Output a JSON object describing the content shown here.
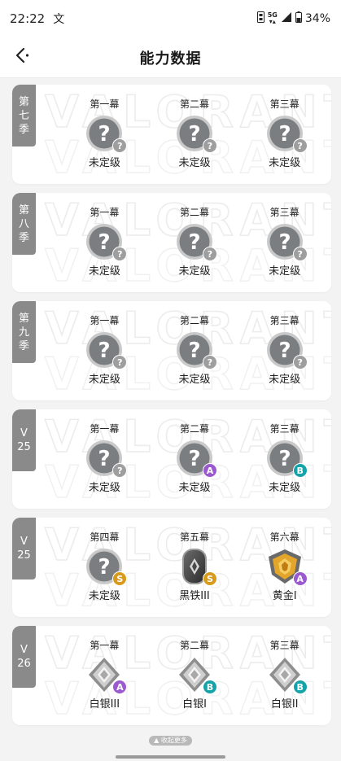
{
  "status_bar": {
    "time": "22:22",
    "notification_glyph": "文",
    "network": "5G",
    "battery": "34%"
  },
  "nav": {
    "title": "能力数据"
  },
  "colors": {
    "tab_bg": "#8a8a8a",
    "badge_gray": "#9e9e9e",
    "badge_purple": "#9b59d0",
    "badge_teal": "#14a3a8",
    "badge_gold": "#d79a1c"
  },
  "seasons": [
    {
      "tab": "第七季",
      "acts": [
        {
          "title": "第一幕",
          "rank": "未定级",
          "icon": "unranked-icon",
          "badge": "?",
          "badge_color": "gray"
        },
        {
          "title": "第二幕",
          "rank": "未定级",
          "icon": "unranked-icon",
          "badge": "?",
          "badge_color": "gray"
        },
        {
          "title": "第三幕",
          "rank": "未定级",
          "icon": "unranked-icon",
          "badge": "?",
          "badge_color": "gray"
        }
      ]
    },
    {
      "tab": "第八季",
      "acts": [
        {
          "title": "第一幕",
          "rank": "未定级",
          "icon": "unranked-icon",
          "badge": "?",
          "badge_color": "gray"
        },
        {
          "title": "第二幕",
          "rank": "未定级",
          "icon": "unranked-icon",
          "badge": "?",
          "badge_color": "gray"
        },
        {
          "title": "第三幕",
          "rank": "未定级",
          "icon": "unranked-icon",
          "badge": "?",
          "badge_color": "gray"
        }
      ]
    },
    {
      "tab": "第九季",
      "acts": [
        {
          "title": "第一幕",
          "rank": "未定级",
          "icon": "unranked-icon",
          "badge": "?",
          "badge_color": "gray"
        },
        {
          "title": "第二幕",
          "rank": "未定级",
          "icon": "unranked-icon",
          "badge": "?",
          "badge_color": "gray"
        },
        {
          "title": "第三幕",
          "rank": "未定级",
          "icon": "unranked-icon",
          "badge": "?",
          "badge_color": "gray"
        }
      ]
    },
    {
      "tab": "V25",
      "acts": [
        {
          "title": "第一幕",
          "rank": "未定级",
          "icon": "unranked-icon",
          "badge": "?",
          "badge_color": "gray"
        },
        {
          "title": "第二幕",
          "rank": "未定级",
          "icon": "unranked-icon",
          "badge": "A",
          "badge_color": "purple"
        },
        {
          "title": "第三幕",
          "rank": "未定级",
          "icon": "unranked-icon",
          "badge": "B",
          "badge_color": "teal"
        }
      ]
    },
    {
      "tab": "V25",
      "acts": [
        {
          "title": "第四幕",
          "rank": "未定级",
          "icon": "unranked-icon",
          "badge": "S",
          "badge_color": "gold"
        },
        {
          "title": "第五幕",
          "rank": "黑铁III",
          "icon": "iron-rank-icon",
          "badge": "S",
          "badge_color": "gold"
        },
        {
          "title": "第六幕",
          "rank": "黄金I",
          "icon": "gold-rank-icon",
          "badge": "A",
          "badge_color": "purple"
        }
      ]
    },
    {
      "tab": "V26",
      "acts": [
        {
          "title": "第一幕",
          "rank": "白银III",
          "icon": "silver-rank-icon",
          "badge": "A",
          "badge_color": "purple"
        },
        {
          "title": "第二幕",
          "rank": "白银I",
          "icon": "silver-rank-icon",
          "badge": "B",
          "badge_color": "teal"
        },
        {
          "title": "第三幕",
          "rank": "白银II",
          "icon": "silver-rank-icon",
          "badge": "B",
          "badge_color": "teal"
        }
      ]
    }
  ],
  "footer": {
    "collapse_label": "收起更多"
  }
}
